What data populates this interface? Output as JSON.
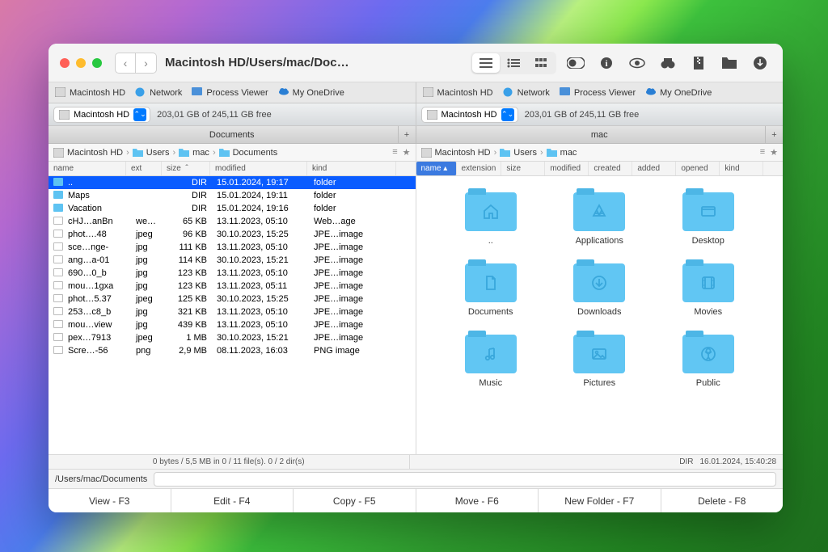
{
  "window": {
    "title": "Macintosh HD/Users/mac/Docu..."
  },
  "drive_tabs": {
    "left": [
      {
        "label": "Macintosh HD",
        "icon": "hdd"
      },
      {
        "label": "Network",
        "icon": "globe"
      },
      {
        "label": "Process Viewer",
        "icon": "proc"
      },
      {
        "label": "My OneDrive",
        "icon": "cloud"
      }
    ],
    "right": [
      {
        "label": "Macintosh HD",
        "icon": "hdd"
      },
      {
        "label": "Network",
        "icon": "globe"
      },
      {
        "label": "Process Viewer",
        "icon": "proc"
      },
      {
        "label": "My OneDrive",
        "icon": "cloud"
      }
    ]
  },
  "storage": {
    "drive": "Macintosh HD",
    "free": "203,01 GB of 245,11 GB free"
  },
  "pane_titles": {
    "left": "Documents",
    "right": "mac"
  },
  "breadcrumbs": {
    "left": [
      "Macintosh HD",
      "Users",
      "mac",
      "Documents"
    ],
    "right": [
      "Macintosh HD",
      "Users",
      "mac"
    ]
  },
  "cols_left": [
    "name",
    "ext",
    "size",
    "modified",
    "kind"
  ],
  "cols_right": [
    "name",
    "extension",
    "size",
    "modified",
    "created",
    "added",
    "opened",
    "kind"
  ],
  "list": [
    {
      "icon": "folder",
      "name": "..",
      "ext": "",
      "size": "DIR",
      "modified": "15.01.2024, 19:17",
      "kind": "folder",
      "sel": true
    },
    {
      "icon": "folder",
      "name": "Maps",
      "ext": "",
      "size": "DIR",
      "modified": "15.01.2024, 19:11",
      "kind": "folder"
    },
    {
      "icon": "folder",
      "name": "Vacation",
      "ext": "",
      "size": "DIR",
      "modified": "15.01.2024, 19:16",
      "kind": "folder"
    },
    {
      "icon": "file",
      "name": "cHJ…anBn",
      "ext": "we…",
      "size": "65 KB",
      "modified": "13.11.2023, 05:10",
      "kind": "Web…age"
    },
    {
      "icon": "file",
      "name": "phot….48",
      "ext": "jpeg",
      "size": "96 KB",
      "modified": "30.10.2023, 15:25",
      "kind": "JPE…image"
    },
    {
      "icon": "file",
      "name": "sce…nge-",
      "ext": "jpg",
      "size": "111 KB",
      "modified": "13.11.2023, 05:10",
      "kind": "JPE…image"
    },
    {
      "icon": "file",
      "name": "ang…a-01",
      "ext": "jpg",
      "size": "114 KB",
      "modified": "30.10.2023, 15:21",
      "kind": "JPE…image"
    },
    {
      "icon": "file",
      "name": "690…0_b",
      "ext": "jpg",
      "size": "123 KB",
      "modified": "13.11.2023, 05:10",
      "kind": "JPE…image"
    },
    {
      "icon": "file",
      "name": "mou…1gxa",
      "ext": "jpg",
      "size": "123 KB",
      "modified": "13.11.2023, 05:11",
      "kind": "JPE…image"
    },
    {
      "icon": "file",
      "name": "phot…5.37",
      "ext": "jpeg",
      "size": "125 KB",
      "modified": "30.10.2023, 15:25",
      "kind": "JPE…image"
    },
    {
      "icon": "file",
      "name": "253…c8_b",
      "ext": "jpg",
      "size": "321 KB",
      "modified": "13.11.2023, 05:10",
      "kind": "JPE…image"
    },
    {
      "icon": "file",
      "name": "mou…view",
      "ext": "jpg",
      "size": "439 KB",
      "modified": "13.11.2023, 05:10",
      "kind": "JPE…image"
    },
    {
      "icon": "file",
      "name": "pex…7913",
      "ext": "jpeg",
      "size": "1 MB",
      "modified": "30.10.2023, 15:21",
      "kind": "JPE…image"
    },
    {
      "icon": "file",
      "name": "Scre…-56",
      "ext": "png",
      "size": "2,9 MB",
      "modified": "08.11.2023, 16:03",
      "kind": "PNG image"
    }
  ],
  "grid": [
    {
      "label": "..",
      "icon": "home"
    },
    {
      "label": "Applications",
      "icon": "apps"
    },
    {
      "label": "Desktop",
      "icon": "desktop"
    },
    {
      "label": "Documents",
      "icon": "doc"
    },
    {
      "label": "Downloads",
      "icon": "download"
    },
    {
      "label": "Movies",
      "icon": "movie"
    },
    {
      "label": "Music",
      "icon": "music"
    },
    {
      "label": "Pictures",
      "icon": "picture"
    },
    {
      "label": "Public",
      "icon": "public"
    }
  ],
  "status": {
    "left": "0 bytes / 5,5 MB in 0 / 11 file(s). 0 / 2 dir(s)",
    "right_kind": "DIR",
    "right_date": "16.01.2024, 15:40:28"
  },
  "path": {
    "label": "/Users/mac/Documents"
  },
  "buttons": [
    "View - F3",
    "Edit - F4",
    "Copy - F5",
    "Move - F6",
    "New Folder - F7",
    "Delete - F8"
  ]
}
